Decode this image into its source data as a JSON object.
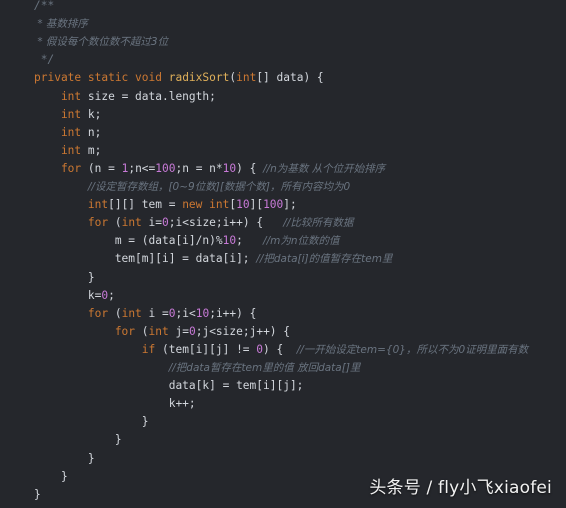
{
  "editor": {
    "lines": [
      [
        {
          "t": "/**",
          "c": "cmt"
        }
      ],
      [
        {
          "t": " * 基数排序",
          "c": "cmt-zh"
        }
      ],
      [
        {
          "t": " * 假设每个数位数不超过3位",
          "c": "cmt-zh"
        }
      ],
      [
        {
          "t": " */",
          "c": "cmt"
        }
      ],
      [
        {
          "t": "private static void ",
          "c": "kw"
        },
        {
          "t": "radixSort",
          "c": "fn"
        },
        {
          "t": "(",
          "c": "plain"
        },
        {
          "t": "int",
          "c": "kw"
        },
        {
          "t": "[] data) {",
          "c": "plain"
        }
      ],
      [
        {
          "t": "    int ",
          "c": "kw"
        },
        {
          "t": "size = data.length;",
          "c": "plain"
        }
      ],
      [
        {
          "t": "    int ",
          "c": "kw"
        },
        {
          "t": "k;",
          "c": "plain"
        }
      ],
      [
        {
          "t": "    int ",
          "c": "kw"
        },
        {
          "t": "n;",
          "c": "plain"
        }
      ],
      [
        {
          "t": "    int ",
          "c": "kw"
        },
        {
          "t": "m;",
          "c": "plain"
        }
      ],
      [
        {
          "t": "    for ",
          "c": "kw"
        },
        {
          "t": "(n = ",
          "c": "plain"
        },
        {
          "t": "1",
          "c": "num"
        },
        {
          "t": ";n<=",
          "c": "plain"
        },
        {
          "t": "100",
          "c": "num"
        },
        {
          "t": ";n = n*",
          "c": "plain"
        },
        {
          "t": "10",
          "c": "num"
        },
        {
          "t": ") { ",
          "c": "plain"
        },
        {
          "t": "//n为基数 从个位开始排序",
          "c": "cmt-zh"
        }
      ],
      [
        {
          "t": "        ",
          "c": "plain"
        },
        {
          "t": "//设定暂存数组，[0~9位数][数据个数]，所有内容均为0",
          "c": "cmt-zh"
        }
      ],
      [
        {
          "t": "        int",
          "c": "kw"
        },
        {
          "t": "[][] tem = ",
          "c": "plain"
        },
        {
          "t": "new int",
          "c": "kw"
        },
        {
          "t": "[",
          "c": "plain"
        },
        {
          "t": "10",
          "c": "num"
        },
        {
          "t": "][",
          "c": "plain"
        },
        {
          "t": "100",
          "c": "num"
        },
        {
          "t": "];",
          "c": "plain"
        }
      ],
      [
        {
          "t": "        for ",
          "c": "kw"
        },
        {
          "t": "(",
          "c": "plain"
        },
        {
          "t": "int ",
          "c": "kw"
        },
        {
          "t": "i=",
          "c": "plain"
        },
        {
          "t": "0",
          "c": "num"
        },
        {
          "t": ";i<size;i++) {   ",
          "c": "plain"
        },
        {
          "t": "//比较所有数据",
          "c": "cmt-zh"
        }
      ],
      [
        {
          "t": "            m = (data[i]/n)%",
          "c": "plain"
        },
        {
          "t": "10",
          "c": "num"
        },
        {
          "t": ";   ",
          "c": "plain"
        },
        {
          "t": "//m为n位数的值",
          "c": "cmt-zh"
        }
      ],
      [
        {
          "t": "            tem[m][i] = data[i]; ",
          "c": "plain"
        },
        {
          "t": "//把data[i]的值暂存在tem里",
          "c": "cmt-zh"
        }
      ],
      [
        {
          "t": "        }",
          "c": "plain"
        }
      ],
      [
        {
          "t": "        k=",
          "c": "plain"
        },
        {
          "t": "0",
          "c": "num"
        },
        {
          "t": ";",
          "c": "plain"
        }
      ],
      [
        {
          "t": "        for ",
          "c": "kw"
        },
        {
          "t": "(",
          "c": "plain"
        },
        {
          "t": "int ",
          "c": "kw"
        },
        {
          "t": "i =",
          "c": "plain"
        },
        {
          "t": "0",
          "c": "num"
        },
        {
          "t": ";i<",
          "c": "plain"
        },
        {
          "t": "10",
          "c": "num"
        },
        {
          "t": ";i++) {",
          "c": "plain"
        }
      ],
      [
        {
          "t": "            for ",
          "c": "kw"
        },
        {
          "t": "(",
          "c": "plain"
        },
        {
          "t": "int ",
          "c": "kw"
        },
        {
          "t": "j=",
          "c": "plain"
        },
        {
          "t": "0",
          "c": "num"
        },
        {
          "t": ";j<size;j++) {",
          "c": "plain"
        }
      ],
      [
        {
          "t": "                if ",
          "c": "kw"
        },
        {
          "t": "(tem[i][j] != ",
          "c": "plain"
        },
        {
          "t": "0",
          "c": "num"
        },
        {
          "t": ") {  ",
          "c": "plain"
        },
        {
          "t": "//一开始设定tem={0}，所以不为0证明里面有数",
          "c": "cmt-zh"
        }
      ],
      [
        {
          "t": "                    ",
          "c": "plain"
        },
        {
          "t": "//把data暂存在tem里的值 放回data[]里",
          "c": "cmt-zh"
        }
      ],
      [
        {
          "t": "                    data[k] = tem[i][j];",
          "c": "plain"
        }
      ],
      [
        {
          "t": "                    k++;",
          "c": "plain"
        }
      ],
      [
        {
          "t": "                }",
          "c": "plain"
        }
      ],
      [
        {
          "t": "            }",
          "c": "plain"
        }
      ],
      [
        {
          "t": "        }",
          "c": "plain"
        }
      ],
      [
        {
          "t": "    }",
          "c": "plain"
        }
      ],
      [
        {
          "t": "}",
          "c": "plain"
        }
      ]
    ]
  },
  "watermark": {
    "text": "头条号 / fly小飞xiaofei"
  }
}
